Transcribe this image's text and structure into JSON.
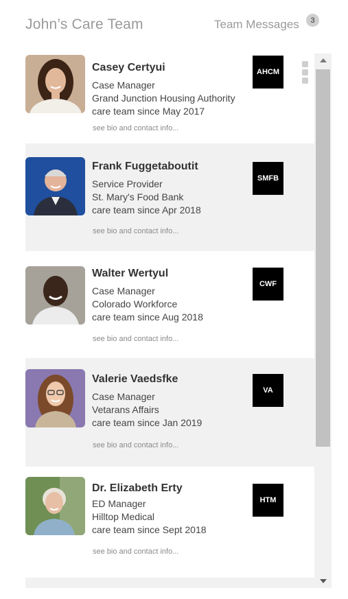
{
  "header": {
    "title": "John’s Care Team",
    "messages_label": "Team Messages",
    "messages_count": "3"
  },
  "members": [
    {
      "name": "Casey Certyui",
      "role": "Case Manager",
      "org": "Grand Junction Housing Authority",
      "since": "care team since May 2017",
      "bio_link": "see bio and contact info...",
      "logo": "AHCM"
    },
    {
      "name": "Frank Fuggetaboutit",
      "role": "Service Provider",
      "org": "St. Mary's Food Bank",
      "since": "care team since Apr 2018",
      "bio_link": "see bio and contact info...",
      "logo": "SMFB"
    },
    {
      "name": "Walter Wertyul",
      "role": "Case Manager",
      "org": "Colorado Workforce",
      "since": "care team since Aug 2018",
      "bio_link": "see bio and contact info...",
      "logo": "CWF"
    },
    {
      "name": "Valerie Vaedsfke",
      "role": "Case Manager",
      "org": "Vetarans Affairs",
      "since": "care team since Jan 2019",
      "bio_link": "see bio and contact info...",
      "logo": "VA"
    },
    {
      "name": "Dr. Elizabeth Erty",
      "role": "ED Manager",
      "org": "Hilltop Medical",
      "since": "care team since Sept 2018",
      "bio_link": "see bio and contact info...",
      "logo": "HTM"
    }
  ],
  "icons": {
    "more": "kebab-menu-icon",
    "scroll_up": "triangle-up-icon",
    "scroll_down": "triangle-down-icon"
  }
}
